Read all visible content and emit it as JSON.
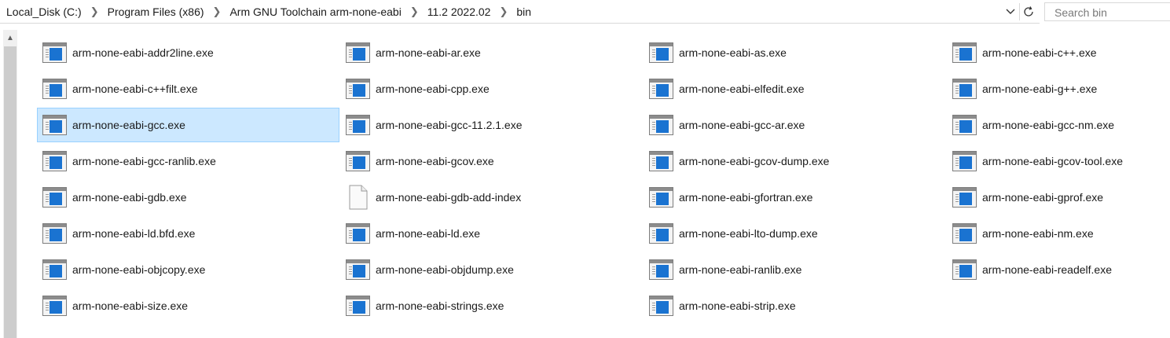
{
  "breadcrumb": [
    "Local_Disk (C:)",
    "Program Files (x86)",
    "Arm GNU Toolchain arm-none-eabi",
    "11.2 2022.02",
    "bin"
  ],
  "search": {
    "placeholder": "Search bin",
    "value": ""
  },
  "icons": {
    "dropdown": "chevron-down-icon",
    "refresh": "refresh-icon",
    "scroll_up": "scroll-up-arrow-icon"
  },
  "colors": {
    "selection_bg": "#cce8ff",
    "selection_border": "#99d1ff",
    "exe_accent": "#1a73d1"
  },
  "files": [
    {
      "name": "arm-none-eabi-addr2line.exe",
      "type": "exe"
    },
    {
      "name": "arm-none-eabi-ar.exe",
      "type": "exe"
    },
    {
      "name": "arm-none-eabi-as.exe",
      "type": "exe"
    },
    {
      "name": "arm-none-eabi-c++.exe",
      "type": "exe"
    },
    {
      "name": "arm-none-eabi-c++filt.exe",
      "type": "exe"
    },
    {
      "name": "arm-none-eabi-cpp.exe",
      "type": "exe"
    },
    {
      "name": "arm-none-eabi-elfedit.exe",
      "type": "exe"
    },
    {
      "name": "arm-none-eabi-g++.exe",
      "type": "exe"
    },
    {
      "name": "arm-none-eabi-gcc.exe",
      "type": "exe",
      "selected": true
    },
    {
      "name": "arm-none-eabi-gcc-11.2.1.exe",
      "type": "exe"
    },
    {
      "name": "arm-none-eabi-gcc-ar.exe",
      "type": "exe"
    },
    {
      "name": "arm-none-eabi-gcc-nm.exe",
      "type": "exe"
    },
    {
      "name": "arm-none-eabi-gcc-ranlib.exe",
      "type": "exe"
    },
    {
      "name": "arm-none-eabi-gcov.exe",
      "type": "exe"
    },
    {
      "name": "arm-none-eabi-gcov-dump.exe",
      "type": "exe"
    },
    {
      "name": "arm-none-eabi-gcov-tool.exe",
      "type": "exe"
    },
    {
      "name": "arm-none-eabi-gdb.exe",
      "type": "exe"
    },
    {
      "name": "arm-none-eabi-gdb-add-index",
      "type": "file"
    },
    {
      "name": "arm-none-eabi-gfortran.exe",
      "type": "exe"
    },
    {
      "name": "arm-none-eabi-gprof.exe",
      "type": "exe"
    },
    {
      "name": "arm-none-eabi-ld.bfd.exe",
      "type": "exe"
    },
    {
      "name": "arm-none-eabi-ld.exe",
      "type": "exe"
    },
    {
      "name": "arm-none-eabi-lto-dump.exe",
      "type": "exe"
    },
    {
      "name": "arm-none-eabi-nm.exe",
      "type": "exe"
    },
    {
      "name": "arm-none-eabi-objcopy.exe",
      "type": "exe"
    },
    {
      "name": "arm-none-eabi-objdump.exe",
      "type": "exe"
    },
    {
      "name": "arm-none-eabi-ranlib.exe",
      "type": "exe"
    },
    {
      "name": "arm-none-eabi-readelf.exe",
      "type": "exe"
    },
    {
      "name": "arm-none-eabi-size.exe",
      "type": "exe"
    },
    {
      "name": "arm-none-eabi-strings.exe",
      "type": "exe"
    },
    {
      "name": "arm-none-eabi-strip.exe",
      "type": "exe"
    }
  ]
}
